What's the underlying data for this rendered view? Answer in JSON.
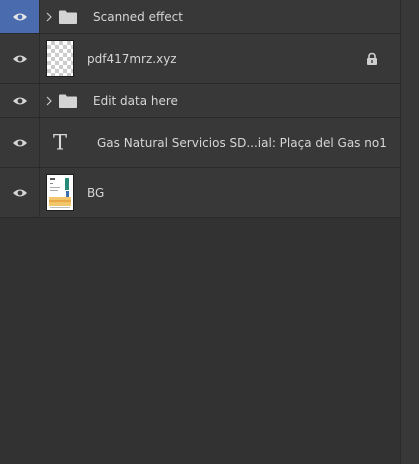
{
  "layers_panel": {
    "layers": [
      {
        "type": "group",
        "name": "Scanned effect",
        "visible": true,
        "selected_eye": true,
        "collapsed": true,
        "icons": [
          "eye-icon",
          "chevron-right-icon",
          "folder-icon"
        ]
      },
      {
        "type": "smart-object",
        "name": "pdf417mrz.xyz",
        "visible": true,
        "locked": true,
        "thumbnail": "transparent-checkerboard",
        "icons": [
          "eye-icon",
          "lock-icon"
        ]
      },
      {
        "type": "group",
        "name": "Edit data here",
        "visible": true,
        "collapsed": true,
        "icons": [
          "eye-icon",
          "chevron-right-icon",
          "folder-icon"
        ]
      },
      {
        "type": "text",
        "name": "Gas Natural Servicios SD...ial: Plaça del Gas no1",
        "visible": true,
        "icons": [
          "eye-icon",
          "type-t-icon"
        ]
      },
      {
        "type": "image",
        "name": "BG",
        "visible": true,
        "thumbnail": "document-scan",
        "icons": [
          "eye-icon"
        ]
      }
    ]
  },
  "colors": {
    "panel_bg": "#323232",
    "row_bg": "#383838",
    "selected_eye_bg": "#4a6cae",
    "text": "#d6d6d6"
  }
}
